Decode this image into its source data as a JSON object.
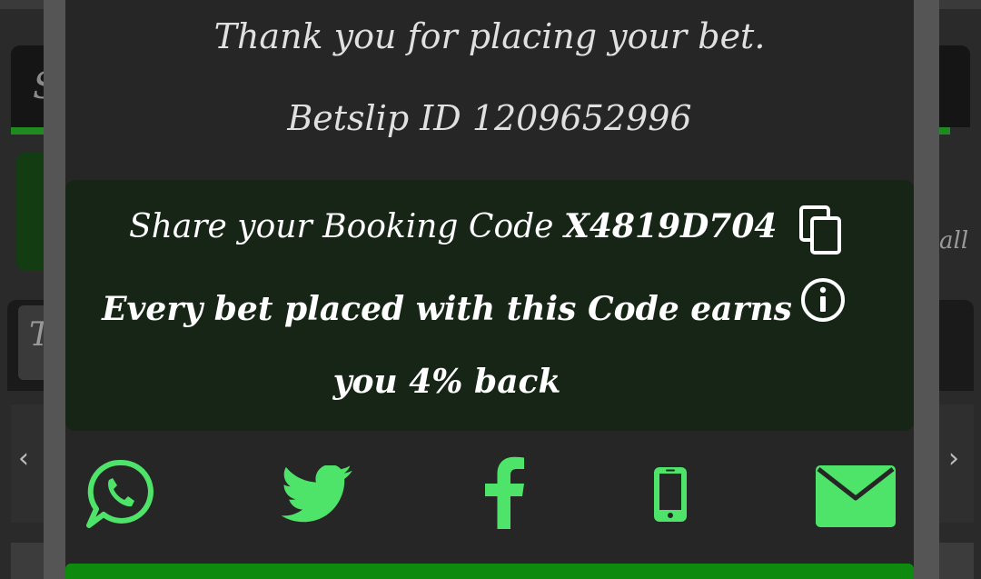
{
  "colors": {
    "accent_green": "#4ee46a",
    "modal_bg": "#262626",
    "booking_box_bg": "#162516",
    "text": "#ffffff"
  },
  "modal": {
    "thank_you": "Thank you for placing your bet.",
    "betslip_id_text": "Betslip ID 1209652996"
  },
  "booking": {
    "share_prefix": "Share your Booking Code",
    "code": "X4819D704",
    "earn_text": "Every bet placed with this Code earns you 4% back",
    "copy_icon": "copy-icon",
    "info_icon": "info-icon"
  },
  "share": {
    "items": [
      {
        "icon": "whatsapp-icon"
      },
      {
        "icon": "twitter-icon"
      },
      {
        "icon": "facebook-icon"
      },
      {
        "icon": "mobile-phone-icon"
      },
      {
        "icon": "email-icon"
      }
    ]
  },
  "background": {
    "left_letter_top": "S",
    "left_letter_mid": "T",
    "right_fragment": "all"
  }
}
